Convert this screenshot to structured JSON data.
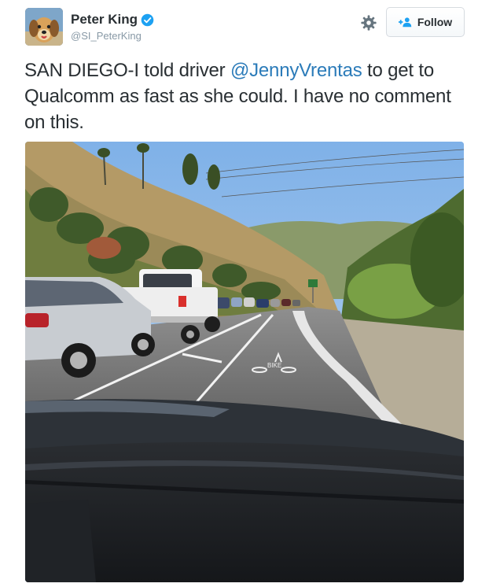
{
  "user": {
    "name": "Peter King",
    "handle": "@SI_PeterKing",
    "verified": true,
    "avatar_icon": "dog-avatar"
  },
  "actions": {
    "settings_icon": "gear-icon",
    "follow_label": "Follow",
    "follow_icon": "add-user-icon"
  },
  "tweet": {
    "text_before": "SAN DIEGO-I told driver ",
    "mention": "@JennyVrentas",
    "text_after": " to get to Qualcomm as fast as she could. I have no comment on this."
  },
  "photo": {
    "description_icon": "traffic-photo",
    "road_marking": "BIKE"
  },
  "colors": {
    "link": "#2b7bb9",
    "verified": "#1da1f2",
    "handle": "#8899a6",
    "text": "#292f33"
  }
}
